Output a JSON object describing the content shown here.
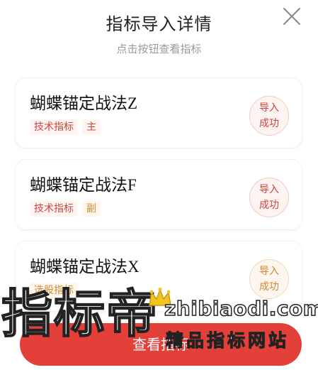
{
  "header": {
    "title": "指标导入详情",
    "subtitle": "点击按钮查看指标"
  },
  "icons": {
    "close": "close-icon",
    "crown": "crown-icon"
  },
  "colors": {
    "accent_red": "#e4403a",
    "tag_red": "#c8473f",
    "tag_orange": "#d18a3a",
    "status_orange": "#cf8736"
  },
  "cards": [
    {
      "name": "蝴蝶锚定战法Z",
      "tags": [
        "技术指标",
        "主"
      ],
      "status": [
        "导入",
        "成功"
      ]
    },
    {
      "name": "蝴蝶锚定战法F",
      "tags": [
        "技术指标",
        "副"
      ],
      "status": [
        "导入",
        "成功"
      ]
    },
    {
      "name": "蝴蝶锚定战法X",
      "tags": [
        "选股指标"
      ],
      "status": [
        "导入",
        "成功"
      ]
    }
  ],
  "footer": {
    "button_label": "查看指标"
  },
  "watermark": {
    "brand": "指标帝",
    "url": "zhibiaodi.com",
    "slogan": "精品指标网站"
  }
}
